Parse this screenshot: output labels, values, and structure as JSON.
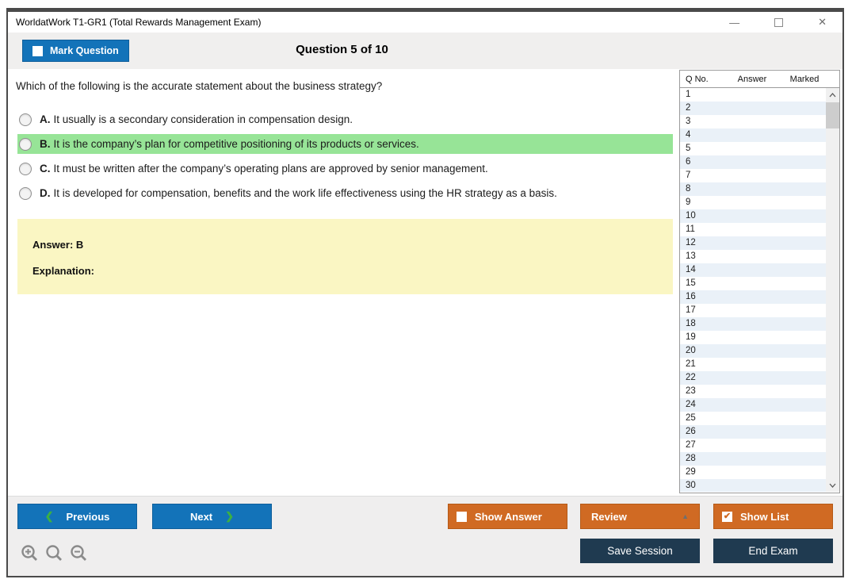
{
  "window": {
    "title": "WorldatWork T1-GR1 (Total Rewards Management Exam)"
  },
  "toolbar": {
    "mark_question_label": "Mark Question",
    "question_counter": "Question 5 of 10"
  },
  "question": {
    "text": "Which of the following is the accurate statement about the business strategy?",
    "highlighted_option_index": 1,
    "options": [
      {
        "letter": "A.",
        "text": "It usually is a secondary consideration in compensation design."
      },
      {
        "letter": "B.",
        "text": "It is the company’s plan for competitive positioning of its products or services."
      },
      {
        "letter": "C.",
        "text": "It must be written after the company’s operating plans are approved by senior management."
      },
      {
        "letter": "D.",
        "text": "It is developed for compensation, benefits and the work life effectiveness using the HR strategy as a basis."
      }
    ]
  },
  "answer_panel": {
    "answer_label": "Answer: B",
    "explanation_label": "Explanation:"
  },
  "question_list": {
    "headers": {
      "qno": "Q No.",
      "answer": "Answer",
      "marked": "Marked"
    },
    "rows": [
      "1",
      "2",
      "3",
      "4",
      "5",
      "6",
      "7",
      "8",
      "9",
      "10",
      "11",
      "12",
      "13",
      "14",
      "15",
      "16",
      "17",
      "18",
      "19",
      "20",
      "21",
      "22",
      "23",
      "24",
      "25",
      "26",
      "27",
      "28",
      "29",
      "30"
    ]
  },
  "footer": {
    "previous_label": "Previous",
    "next_label": "Next",
    "show_answer_label": "Show Answer",
    "review_label": "Review",
    "show_list_label": "Show List",
    "save_session_label": "Save Session",
    "end_exam_label": "End Exam"
  },
  "icons": {
    "minimize_glyph": "—",
    "close_glyph": "✕",
    "check_glyph": "✔",
    "review_caret_glyph": "▲",
    "prev_chevron_glyph": "❮",
    "next_chevron_glyph": "❯"
  },
  "colors": {
    "accent_blue": "#1373B9",
    "accent_orange": "#D06A23",
    "navy": "#1F3A50",
    "highlight_green": "#97E497",
    "answer_yellow": "#FAF6C3",
    "row_alt": "#EAF1F8",
    "chevron_green": "#3CB043"
  }
}
